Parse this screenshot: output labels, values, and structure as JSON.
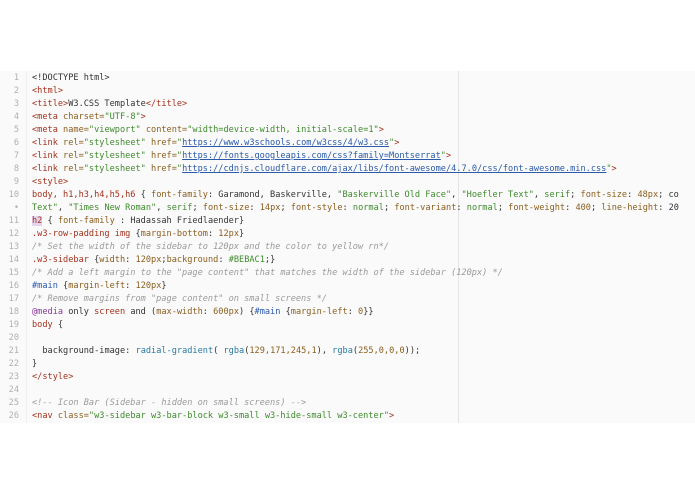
{
  "editor": {
    "lines": [
      {
        "n": "1",
        "tokens": [
          {
            "t": "<!DOCTYPE html>",
            "c": "plain"
          }
        ]
      },
      {
        "n": "2",
        "tokens": [
          {
            "t": "<html>",
            "c": "tag"
          }
        ]
      },
      {
        "n": "3",
        "tokens": [
          {
            "t": "<title>",
            "c": "tag"
          },
          {
            "t": "W3.CSS Template",
            "c": "plain"
          },
          {
            "t": "</title>",
            "c": "tag"
          }
        ]
      },
      {
        "n": "4",
        "tokens": [
          {
            "t": "<meta ",
            "c": "tag"
          },
          {
            "t": "charset=",
            "c": "attr"
          },
          {
            "t": "\"UTF-8\"",
            "c": "str"
          },
          {
            "t": ">",
            "c": "tag"
          }
        ]
      },
      {
        "n": "5",
        "tokens": [
          {
            "t": "<meta ",
            "c": "tag"
          },
          {
            "t": "name=",
            "c": "attr"
          },
          {
            "t": "\"viewport\" ",
            "c": "str"
          },
          {
            "t": "content=",
            "c": "attr"
          },
          {
            "t": "\"width=device-width, initial-scale=1\"",
            "c": "str"
          },
          {
            "t": ">",
            "c": "tag"
          }
        ]
      },
      {
        "n": "6",
        "tokens": [
          {
            "t": "<link ",
            "c": "tag"
          },
          {
            "t": "rel=",
            "c": "attr"
          },
          {
            "t": "\"stylesheet\" ",
            "c": "str"
          },
          {
            "t": "href=",
            "c": "attr"
          },
          {
            "t": "\"",
            "c": "str"
          },
          {
            "t": "https://www.w3schools.com/w3css/4/w3.css",
            "c": "link"
          },
          {
            "t": "\"",
            "c": "str"
          },
          {
            "t": ">",
            "c": "tag"
          }
        ]
      },
      {
        "n": "7",
        "tokens": [
          {
            "t": "<link ",
            "c": "tag"
          },
          {
            "t": "rel=",
            "c": "attr"
          },
          {
            "t": "\"stylesheet\" ",
            "c": "str"
          },
          {
            "t": "href=",
            "c": "attr"
          },
          {
            "t": "\"",
            "c": "str"
          },
          {
            "t": "https://fonts.googleapis.com/css?family=Montserrat",
            "c": "link"
          },
          {
            "t": "\"",
            "c": "str"
          },
          {
            "t": ">",
            "c": "tag"
          }
        ]
      },
      {
        "n": "8",
        "tokens": [
          {
            "t": "<link ",
            "c": "tag"
          },
          {
            "t": "rel=",
            "c": "attr"
          },
          {
            "t": "\"stylesheet\" ",
            "c": "str"
          },
          {
            "t": "href=",
            "c": "attr"
          },
          {
            "t": "\"",
            "c": "str"
          },
          {
            "t": "https://cdnjs.cloudflare.com/ajax/libs/font-awesome/4.7.0/css/font-awesome.min.css",
            "c": "link"
          },
          {
            "t": "\"",
            "c": "str"
          },
          {
            "t": ">",
            "c": "tag"
          }
        ]
      },
      {
        "n": "9",
        "tokens": [
          {
            "t": "<style>",
            "c": "tag"
          }
        ]
      },
      {
        "n": "10",
        "tokens": [
          {
            "t": "body, h1,h3,h4,h5,h6",
            "c": "sel"
          },
          {
            "t": " { ",
            "c": "plain"
          },
          {
            "t": "font-family",
            "c": "prop"
          },
          {
            "t": ": Garamond, Baskerville, ",
            "c": "plain"
          },
          {
            "t": "\"Baskerville Old Face\"",
            "c": "str"
          },
          {
            "t": ", ",
            "c": "plain"
          },
          {
            "t": "\"Hoefler Text\"",
            "c": "str"
          },
          {
            "t": ", ",
            "c": "plain"
          },
          {
            "t": "serif",
            "c": "str"
          },
          {
            "t": "; ",
            "c": "plain"
          },
          {
            "t": "font-size",
            "c": "prop"
          },
          {
            "t": ": ",
            "c": "plain"
          },
          {
            "t": "48px",
            "c": "num"
          },
          {
            "t": "; co",
            "c": "plain"
          }
        ]
      },
      {
        "n": "•",
        "tokens": [
          {
            "t": "Text\"",
            "c": "str"
          },
          {
            "t": ", ",
            "c": "plain"
          },
          {
            "t": "\"Times New Roman\"",
            "c": "str"
          },
          {
            "t": ", ",
            "c": "plain"
          },
          {
            "t": "serif",
            "c": "str"
          },
          {
            "t": "; ",
            "c": "plain"
          },
          {
            "t": "font-size",
            "c": "prop"
          },
          {
            "t": ": ",
            "c": "plain"
          },
          {
            "t": "14px",
            "c": "num"
          },
          {
            "t": "; ",
            "c": "plain"
          },
          {
            "t": "font-style",
            "c": "prop"
          },
          {
            "t": ": ",
            "c": "plain"
          },
          {
            "t": "normal",
            "c": "str"
          },
          {
            "t": "; ",
            "c": "plain"
          },
          {
            "t": "font-variant",
            "c": "prop"
          },
          {
            "t": ": ",
            "c": "plain"
          },
          {
            "t": "normal",
            "c": "str"
          },
          {
            "t": "; ",
            "c": "plain"
          },
          {
            "t": "font-weight",
            "c": "prop"
          },
          {
            "t": ": ",
            "c": "plain"
          },
          {
            "t": "400",
            "c": "num"
          },
          {
            "t": "; ",
            "c": "plain"
          },
          {
            "t": "line-height",
            "c": "prop"
          },
          {
            "t": ": 20",
            "c": "plain"
          }
        ]
      },
      {
        "n": "11",
        "tokens": [
          {
            "t": "h2",
            "c": "hl"
          },
          {
            "t": " { ",
            "c": "plain"
          },
          {
            "t": "font-family",
            "c": "prop"
          },
          {
            "t": " : Hadassah Friedlaender}",
            "c": "plain"
          }
        ]
      },
      {
        "n": "12",
        "tokens": [
          {
            "t": ".w3-row-padding img",
            "c": "sel"
          },
          {
            "t": " {",
            "c": "plain"
          },
          {
            "t": "margin-bottom",
            "c": "prop"
          },
          {
            "t": ": ",
            "c": "plain"
          },
          {
            "t": "12px",
            "c": "num"
          },
          {
            "t": "}",
            "c": "plain"
          }
        ]
      },
      {
        "n": "13",
        "tokens": [
          {
            "t": "/* Set the width of the sidebar to 120px and the color to yellow rn*/",
            "c": "comment"
          }
        ]
      },
      {
        "n": "14",
        "tokens": [
          {
            "t": ".w3-sidebar",
            "c": "sel"
          },
          {
            "t": " {",
            "c": "plain"
          },
          {
            "t": "width",
            "c": "prop"
          },
          {
            "t": ": ",
            "c": "plain"
          },
          {
            "t": "120px",
            "c": "num"
          },
          {
            "t": ";",
            "c": "plain"
          },
          {
            "t": "background",
            "c": "prop"
          },
          {
            "t": ": ",
            "c": "plain"
          },
          {
            "t": "#BEBAC1",
            "c": "hex"
          },
          {
            "t": ";}",
            "c": "plain"
          }
        ]
      },
      {
        "n": "15",
        "tokens": [
          {
            "t": "/* Add a left margin to the \"page content\" that matches the width of the sidebar (120px) */",
            "c": "comment"
          }
        ]
      },
      {
        "n": "16",
        "tokens": [
          {
            "t": "#main",
            "c": "id"
          },
          {
            "t": " {",
            "c": "plain"
          },
          {
            "t": "margin-left",
            "c": "prop"
          },
          {
            "t": ": ",
            "c": "plain"
          },
          {
            "t": "120px",
            "c": "num"
          },
          {
            "t": "}",
            "c": "plain"
          }
        ]
      },
      {
        "n": "17",
        "tokens": [
          {
            "t": "/* Remove margins from \"page content\" on small screens */",
            "c": "comment"
          }
        ]
      },
      {
        "n": "18",
        "tokens": [
          {
            "t": "@media",
            "c": "kw"
          },
          {
            "t": " only ",
            "c": "plain"
          },
          {
            "t": "screen",
            "c": "sel"
          },
          {
            "t": " and (",
            "c": "plain"
          },
          {
            "t": "max-width",
            "c": "prop"
          },
          {
            "t": ": ",
            "c": "plain"
          },
          {
            "t": "600px",
            "c": "num"
          },
          {
            "t": ") {",
            "c": "plain"
          },
          {
            "t": "#main",
            "c": "id"
          },
          {
            "t": " {",
            "c": "plain"
          },
          {
            "t": "margin-left",
            "c": "prop"
          },
          {
            "t": ": ",
            "c": "plain"
          },
          {
            "t": "0",
            "c": "num"
          },
          {
            "t": "}}",
            "c": "plain"
          }
        ]
      },
      {
        "n": "19",
        "tokens": [
          {
            "t": "body",
            "c": "sel"
          },
          {
            "t": " {",
            "c": "plain"
          }
        ]
      },
      {
        "n": "20",
        "tokens": []
      },
      {
        "n": "21",
        "tokens": [
          {
            "t": "  ",
            "c": "plain"
          },
          {
            "t": "background-image",
            "c": "plain"
          },
          {
            "t": ": ",
            "c": "plain"
          },
          {
            "t": "radial-gradient",
            "c": "fn"
          },
          {
            "t": "( ",
            "c": "plain"
          },
          {
            "t": "rgba",
            "c": "fn"
          },
          {
            "t": "(",
            "c": "plain"
          },
          {
            "t": "129,171,245,1",
            "c": "num"
          },
          {
            "t": "), ",
            "c": "plain"
          },
          {
            "t": "rgba",
            "c": "fn"
          },
          {
            "t": "(",
            "c": "plain"
          },
          {
            "t": "255,0,0,0",
            "c": "num"
          },
          {
            "t": "));",
            "c": "plain"
          }
        ]
      },
      {
        "n": "22",
        "tokens": [
          {
            "t": "}",
            "c": "plain"
          }
        ]
      },
      {
        "n": "23",
        "tokens": [
          {
            "t": "</style>",
            "c": "tag"
          }
        ]
      },
      {
        "n": "24",
        "tokens": []
      },
      {
        "n": "25",
        "tokens": [
          {
            "t": "<!-- Icon Bar (Sidebar - hidden on small screens) -->",
            "c": "comment"
          }
        ]
      },
      {
        "n": "26",
        "tokens": [
          {
            "t": "<nav ",
            "c": "tag"
          },
          {
            "t": "class=",
            "c": "attr"
          },
          {
            "t": "\"w3-sidebar w3-bar-block w3-small w3-hide-small w3-center\"",
            "c": "str"
          },
          {
            "t": ">",
            "c": "tag"
          }
        ]
      }
    ]
  }
}
